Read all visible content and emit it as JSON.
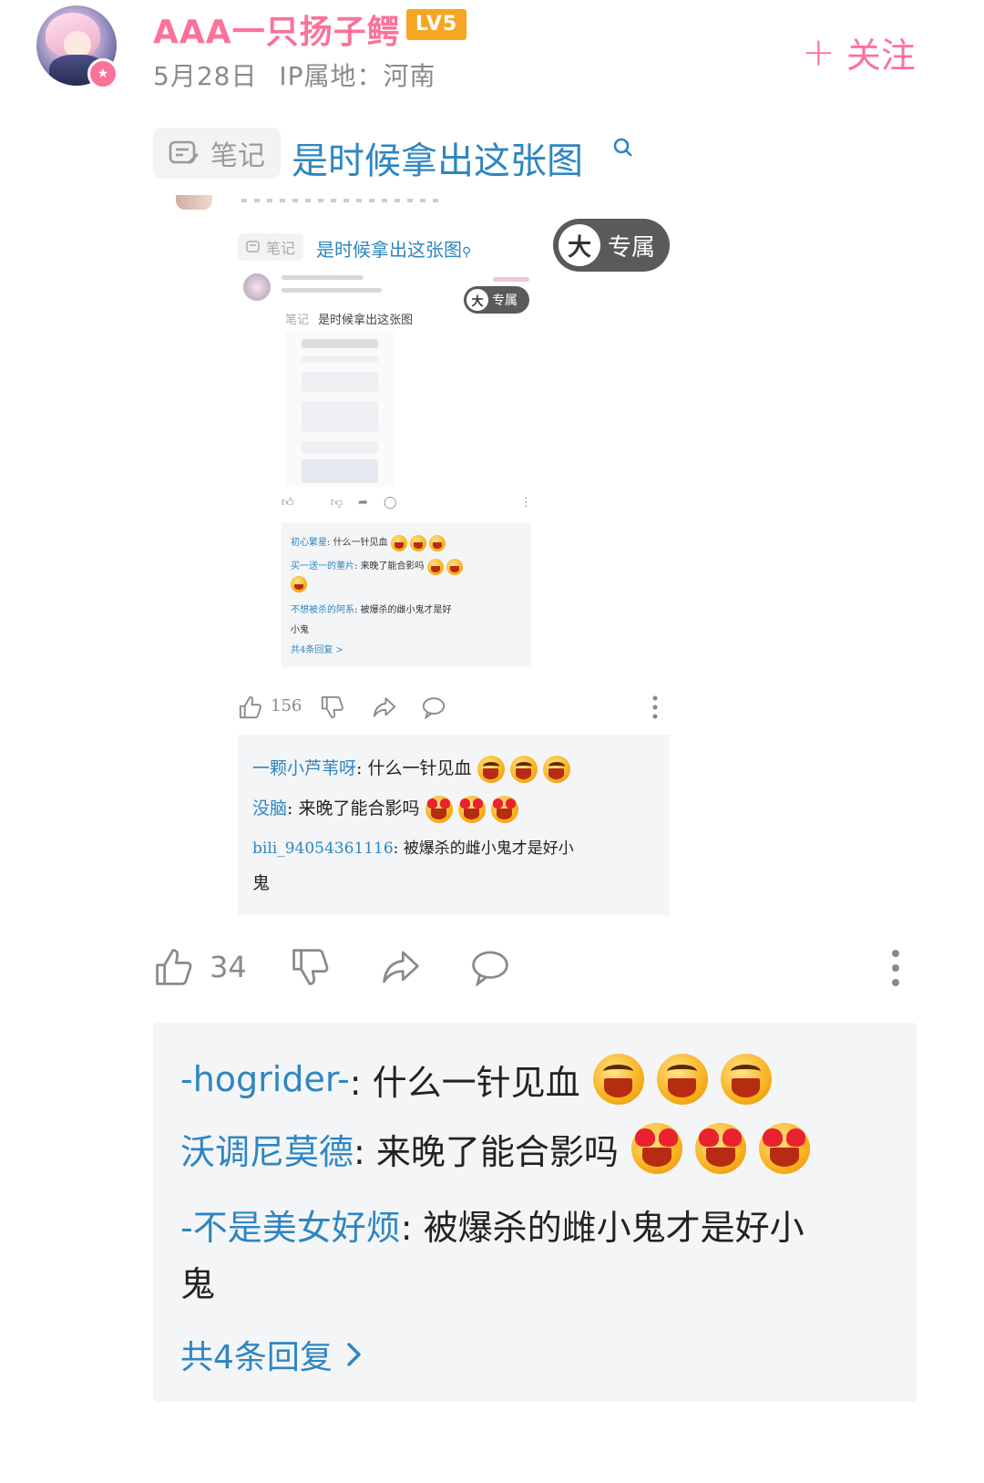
{
  "post": {
    "username": "AAA一只扬子鳄",
    "level": "LV5",
    "date": "5月28日",
    "ip_location": "IP属地：河南",
    "follow_label": "关注",
    "note_tag": "笔记",
    "note_title": "是时候拿出这张图",
    "like_count": "34"
  },
  "embedded": {
    "note_tag": "笔记",
    "note_title": "是时候拿出这张图",
    "exclusive_label": "专属",
    "badge_char": "大",
    "like_count": "156",
    "nested_note_title": "是时候拿出这张图",
    "nested_replies": [
      {
        "name": "初心繁星",
        "text": "什么一针见血"
      },
      {
        "name": "买一送一的董片",
        "text": "来晚了能合影吗"
      },
      {
        "name": "不想被杀的阿系",
        "text": "被爆杀的雌小鬼才是好"
      },
      {
        "name": "",
        "text": "小鬼"
      },
      {
        "name": "",
        "text": "共4条回复 >"
      }
    ],
    "replies": [
      {
        "name": "一颗小芦苇呀",
        "text": ": 什么一针见血"
      },
      {
        "name": "没脑",
        "text": ": 来晚了能合影吗"
      },
      {
        "name": "bili_94054361116",
        "text": ": 被爆杀的雌小鬼才是好小"
      },
      {
        "name": "",
        "text": "鬼"
      }
    ]
  },
  "replies": [
    {
      "name": "-hogrider-",
      "text": ": 什么一针见血",
      "emoji": "laugh"
    },
    {
      "name": "沃调尼莫德",
      "text": ": 来晚了能合影吗",
      "emoji": "heart-eyes"
    },
    {
      "name": "-不是美女好烦",
      "text": ": 被爆杀的雌小鬼才是好小",
      "emoji": ""
    }
  ],
  "reply_wrap_text": "鬼",
  "more_replies": "共4条回复",
  "colors": {
    "accent": "#fb7299",
    "link": "#2e86c1",
    "level": "#f6a623"
  }
}
